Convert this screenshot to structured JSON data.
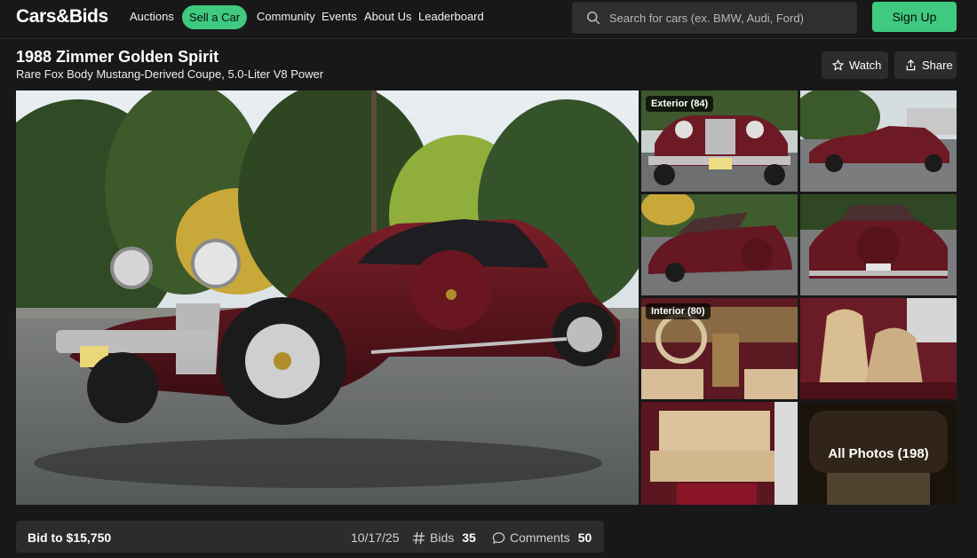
{
  "header": {
    "logo": "Cars&Bids",
    "nav": [
      "Auctions",
      "Community",
      "Events",
      "About Us",
      "Leaderboard"
    ],
    "sell_label": "Sell a Car",
    "search": {
      "placeholder": "Search for cars (ex. BMW, Audi, Ford)",
      "value": ""
    },
    "signup_label": "Sign Up",
    "accent_color": "#3fca80"
  },
  "listing": {
    "title": "1988 Zimmer Golden Spirit",
    "subtitle": "Rare Fox Body Mustang-Derived Coupe, 5.0-Liter V8 Power",
    "watch_label": "Watch",
    "share_label": "Share"
  },
  "gallery": {
    "exterior_badge": "Exterior (84)",
    "interior_badge": "Interior (80)",
    "all_photos_label": "All Photos (198)"
  },
  "bid_bar": {
    "bid_label": "Bid to $15,750",
    "end_date": "10/17/25",
    "bids_label": "Bids",
    "bids_count": "35",
    "comments_label": "Comments",
    "comments_count": "50"
  }
}
